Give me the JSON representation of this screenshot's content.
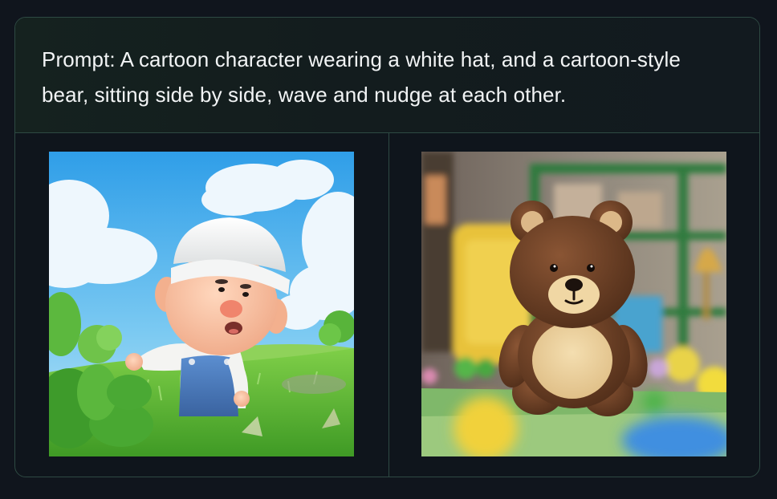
{
  "prompt": {
    "text": "Prompt: A cartoon character wearing a white hat, and a cartoon-style bear, sitting side by side, wave and nudge at each other."
  },
  "images": [
    {
      "subject": "cartoon-character-white-hat"
    },
    {
      "subject": "cartoon-bear"
    }
  ],
  "colors": {
    "page_background": "#10151d",
    "card_border": "#2e4a43",
    "prompt_text": "#f2f4f5"
  }
}
